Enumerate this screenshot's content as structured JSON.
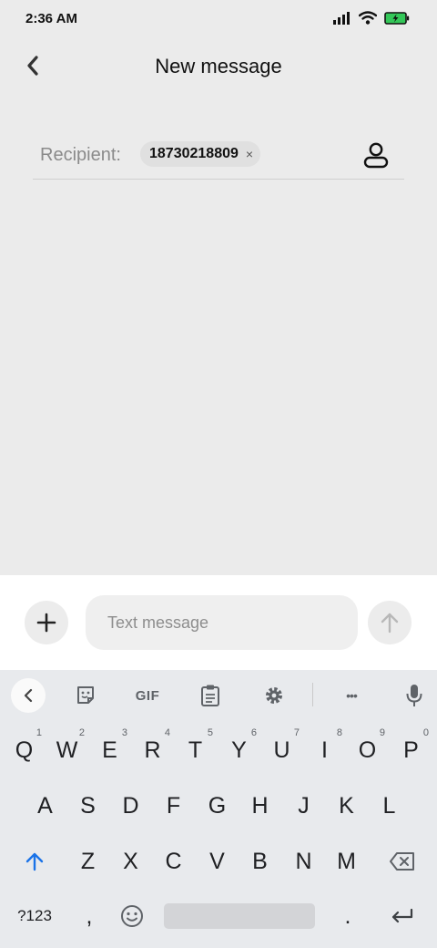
{
  "status": {
    "time": "2:36 AM"
  },
  "header": {
    "title": "New message"
  },
  "recipient": {
    "label": "Recipient:",
    "chip_number": "18730218809",
    "chip_remove": "×"
  },
  "compose": {
    "placeholder": "Text message"
  },
  "keyboard": {
    "toolbar": {
      "gif_label": "GIF",
      "more_label": "•••"
    },
    "rows": [
      [
        "Q",
        "W",
        "E",
        "R",
        "T",
        "Y",
        "U",
        "I",
        "O",
        "P"
      ],
      [
        "A",
        "S",
        "D",
        "F",
        "G",
        "H",
        "J",
        "K",
        "L"
      ],
      [
        "Z",
        "X",
        "C",
        "V",
        "B",
        "N",
        "M"
      ]
    ],
    "number_hints": [
      "1",
      "2",
      "3",
      "4",
      "5",
      "6",
      "7",
      "8",
      "9",
      "0"
    ],
    "symbols_label": "?123",
    "comma_label": ",",
    "period_label": "."
  },
  "colors": {
    "accent": "#1a73e8",
    "battery": "#34c759"
  }
}
